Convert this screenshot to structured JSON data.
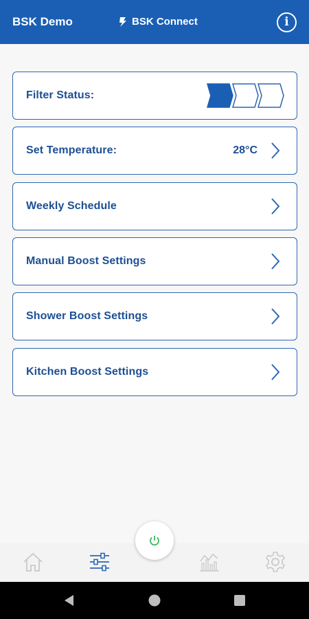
{
  "header": {
    "title": "BSK Demo",
    "brand": "BSK Connect",
    "info_icon": "info-icon",
    "color": "#1a5fb4"
  },
  "cards": {
    "filter_status": {
      "label": "Filter Status:",
      "level_filled": 1,
      "level_total": 3
    },
    "set_temperature": {
      "label": "Set Temperature:",
      "value": "28°C"
    },
    "weekly_schedule": {
      "label": "Weekly Schedule"
    },
    "manual_boost": {
      "label": "Manual Boost Settings"
    },
    "shower_boost": {
      "label": "Shower Boost Settings"
    },
    "kitchen_boost": {
      "label": "Kitchen Boost Settings"
    }
  },
  "bottom_nav": {
    "items": [
      "home-icon",
      "sliders-icon",
      "power-icon",
      "chart-icon",
      "gear-icon"
    ],
    "power_color": "#3cb55a"
  },
  "system_bar": [
    "back-icon",
    "home-circle-icon",
    "recents-icon"
  ]
}
